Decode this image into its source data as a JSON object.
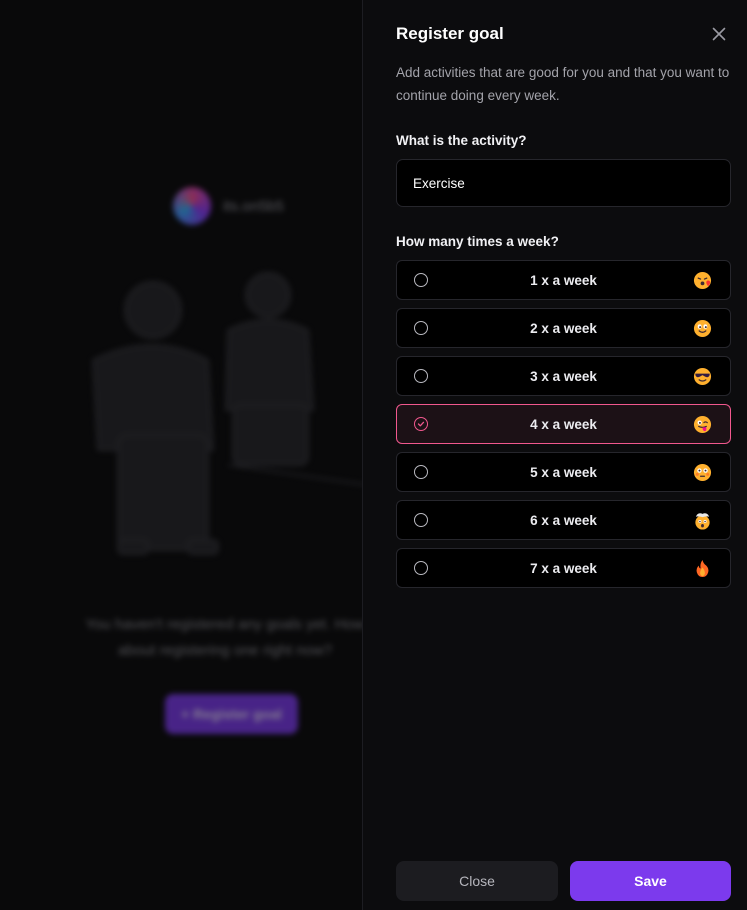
{
  "background": {
    "logo_text": "its.on5b5",
    "empty_message": "You haven't registered any goals yet. How about registering one right now?",
    "register_button_label": "+ Register goal"
  },
  "drawer": {
    "title": "Register goal",
    "description": "Add activities that are good for you and that you want to continue doing every week.",
    "activity_label": "What is the activity?",
    "activity_value": "Exercise",
    "frequency_label": "How many times a week?",
    "options": [
      {
        "label": "1 x a week",
        "icon": "kissing-face-icon",
        "selected": false
      },
      {
        "label": "2 x a week",
        "icon": "smiling-face-icon",
        "selected": false
      },
      {
        "label": "3 x a week",
        "icon": "sunglasses-face-icon",
        "selected": false
      },
      {
        "label": "4 x a week",
        "icon": "tongue-wink-face-icon",
        "selected": true
      },
      {
        "label": "5 x a week",
        "icon": "flushed-face-icon",
        "selected": false
      },
      {
        "label": "6 x a week",
        "icon": "exploding-head-icon",
        "selected": false
      },
      {
        "label": "7 x a week",
        "icon": "fire-icon",
        "selected": false
      }
    ],
    "close_label": "Close",
    "save_label": "Save"
  },
  "colors": {
    "accent": "#7c3aed",
    "selected_border": "#f0588e",
    "background": "#09090a"
  }
}
